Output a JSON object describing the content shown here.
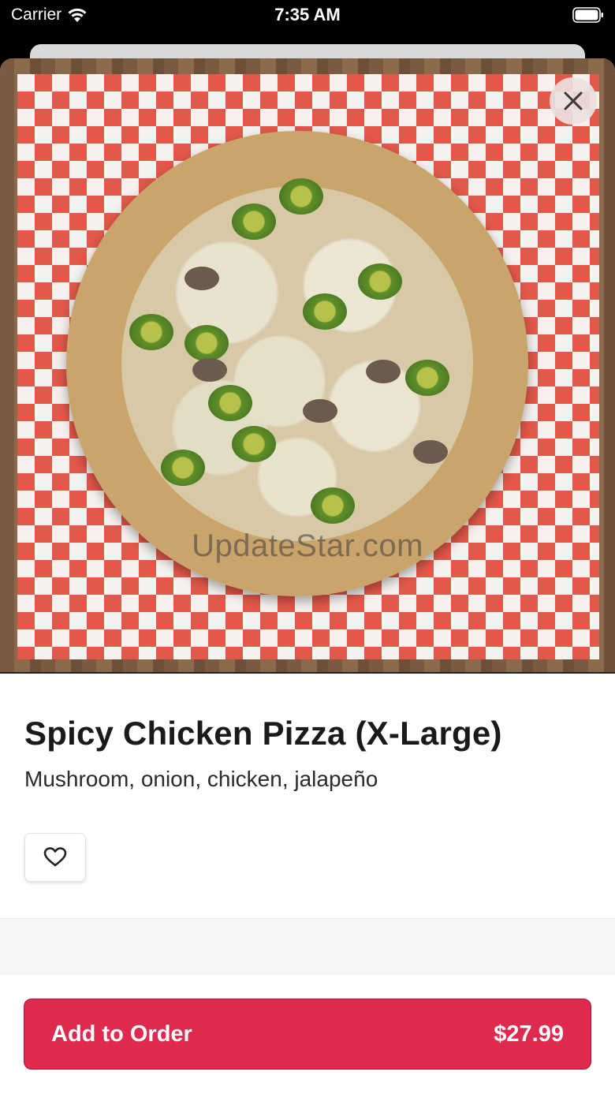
{
  "status_bar": {
    "carrier": "Carrier",
    "time": "7:35 AM"
  },
  "hero": {
    "watermark": "UpdateStar.com"
  },
  "item": {
    "name": "Spicy Chicken Pizza (X-Large)",
    "description": "Mushroom, onion, chicken, jalapeño"
  },
  "actions": {
    "add_label": "Add to Order",
    "price": "$27.99"
  },
  "icons": {
    "close": "close-icon",
    "favorite": "heart-icon",
    "wifi": "wifi-icon",
    "battery": "battery-icon"
  },
  "colors": {
    "accent": "#e0294f",
    "checker_red": "#e2584a"
  }
}
